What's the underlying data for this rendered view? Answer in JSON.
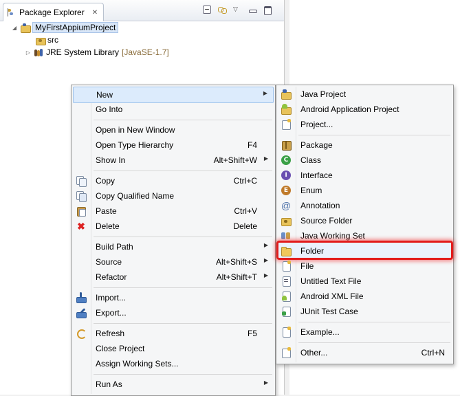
{
  "view": {
    "tab_label": "Package Explorer",
    "tab_close": "✕"
  },
  "tree": {
    "project": "MyFirstAppiumProject",
    "src": "src",
    "jre": "JRE System Library",
    "jre_version": "[JavaSE-1.7]"
  },
  "context_menu": {
    "new": "New",
    "go_into": "Go Into",
    "open_new_window": "Open in New Window",
    "open_type_hierarchy": {
      "label": "Open Type Hierarchy",
      "shortcut": "F4"
    },
    "show_in": {
      "label": "Show In",
      "shortcut": "Alt+Shift+W"
    },
    "copy": {
      "label": "Copy",
      "shortcut": "Ctrl+C"
    },
    "copy_qualified": "Copy Qualified Name",
    "paste": {
      "label": "Paste",
      "shortcut": "Ctrl+V"
    },
    "delete": {
      "label": "Delete",
      "shortcut": "Delete"
    },
    "build_path": "Build Path",
    "source": {
      "label": "Source",
      "shortcut": "Alt+Shift+S"
    },
    "refactor": {
      "label": "Refactor",
      "shortcut": "Alt+Shift+T"
    },
    "import": "Import...",
    "export": "Export...",
    "refresh": {
      "label": "Refresh",
      "shortcut": "F5"
    },
    "close_project": "Close Project",
    "assign_working_sets": "Assign Working Sets...",
    "run_as": "Run As"
  },
  "submenu": {
    "java_project": "Java Project",
    "android_app_project": "Android Application Project",
    "project": "Project...",
    "package": "Package",
    "class": "Class",
    "interface": "Interface",
    "enum": "Enum",
    "annotation": "Annotation",
    "source_folder": "Source Folder",
    "java_working_set": "Java Working Set",
    "folder": "Folder",
    "file": "File",
    "untitled_text_file": "Untitled Text File",
    "android_xml_file": "Android XML File",
    "junit_test_case": "JUnit Test Case",
    "example": "Example...",
    "other": {
      "label": "Other...",
      "shortcut": "Ctrl+N"
    }
  },
  "colors": {
    "highlight_border": "#e21c1c",
    "menu_bg": "#f5f6f7",
    "hover_bg": "#dcebfc"
  }
}
